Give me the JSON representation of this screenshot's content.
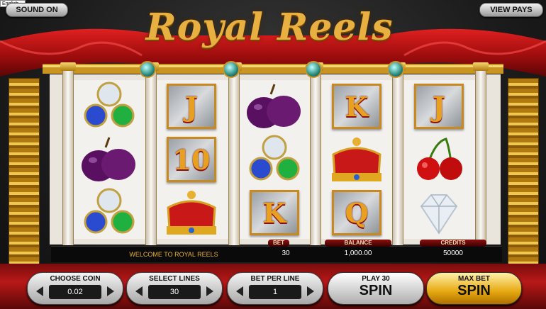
{
  "language_select": "English",
  "top_bar": {
    "sound_label": "SOUND ON",
    "view_pays_label": "VIEW PAYS"
  },
  "game_title": "Royal Reels",
  "reels": [
    [
      "gems-cluster",
      "plum",
      "gems-cluster"
    ],
    [
      "J",
      "10",
      "crown"
    ],
    [
      "plum",
      "gems-cluster",
      "K"
    ],
    [
      "K",
      "crown",
      "Q"
    ],
    [
      "J",
      "cherry",
      "diamond"
    ]
  ],
  "info": {
    "welcome": "WELCOME TO ROYAL REELS",
    "bet_label": "BET",
    "bet_value": "30",
    "balance_label": "BALANCE",
    "balance_value": "1,000.00",
    "credits_label": "CREDITS",
    "credits_value": "50000"
  },
  "controls": {
    "choose_coin_label": "CHOOSE COIN",
    "choose_coin_value": "0.02",
    "select_lines_label": "SELECT LINES",
    "select_lines_value": "30",
    "bet_per_line_label": "BET PER LINE",
    "bet_per_line_value": "1",
    "play_label": "PLAY 30",
    "spin_label": "SPIN",
    "max_bet_label": "MAX BET",
    "max_spin_label": "SPIN"
  },
  "colors": {
    "gold": "#e8b040",
    "curtain_red": "#b81818",
    "card_letter": "#e8a020"
  }
}
